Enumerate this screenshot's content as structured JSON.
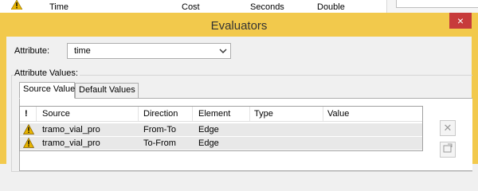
{
  "background": {
    "columns": [
      "Time",
      "Cost",
      "Seconds",
      "Double"
    ]
  },
  "dialog": {
    "title": "Evaluators",
    "close_label": "×",
    "attribute_label": "Attribute:",
    "attribute_value": "time",
    "group_label": "Attribute Values:",
    "tabs": [
      {
        "label": "Source Values",
        "active": true
      },
      {
        "label": "Default Values",
        "active": false
      }
    ],
    "grid": {
      "columns": [
        "!",
        "Source",
        "Direction",
        "Element",
        "Type",
        "Value"
      ],
      "rows": [
        {
          "source": "tramo_vial_pro",
          "direction": "From-To",
          "element": "Edge",
          "type": "",
          "value": ""
        },
        {
          "source": "tramo_vial_pro",
          "direction": "To-From",
          "element": "Edge",
          "type": "",
          "value": ""
        }
      ]
    },
    "side_buttons": [
      "delete-icon",
      "properties-icon"
    ]
  },
  "colors": {
    "title_bar": "#f2c94c",
    "close_button": "#c73b3b",
    "warning": "#e8b400"
  }
}
